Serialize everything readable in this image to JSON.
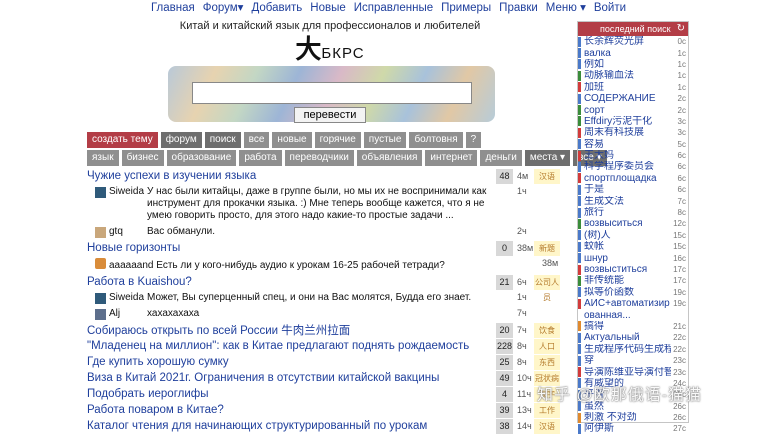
{
  "nav": [
    "Главная",
    "Форум▾",
    "Добавить",
    "Новые",
    "Исправленные",
    "Примеры",
    "Правки",
    "Меню ▾",
    "Войти"
  ],
  "subtitle": "Китай и китайский язык для профессионалов и любителей",
  "logo": {
    "char": "大",
    "text": "БКРС"
  },
  "search": {
    "value": "",
    "button": "перевести"
  },
  "row1": [
    "создать тему",
    "форум",
    "поиск",
    "все",
    "новые",
    "горячие",
    "пустые",
    "болтовня",
    "?"
  ],
  "row2": [
    "язык",
    "бизнес",
    "образование",
    "работа",
    "переводчики",
    "объявления",
    "интернет",
    "деньги",
    "места ▾",
    "все ▾"
  ],
  "threads": [
    {
      "title": "Чужие успехи в изучении языка",
      "count": "48",
      "age": "4м",
      "tag": "汉语"
    },
    {
      "post": {
        "user": "Siweida",
        "text": "У нас были китайцы, даже в группе были, но мы их не воспринимали как инструмент для прокачки языка. :) Мне теперь вообще кажется, что я не умею говорить просто, для этого надо какие-то простые задачи ...",
        "age": "1ч"
      }
    },
    {
      "post": {
        "user": "gtq",
        "text": "Вас обманули.",
        "age": "2ч"
      }
    },
    {
      "title": "Новые горизонты",
      "count": "0",
      "age": "38м",
      "tag": "新题"
    },
    {
      "inline": {
        "user": "aaaaaand",
        "text": "Есть ли у кого-нибудь аудио к урокам 16-25 рабочей тетради?",
        "age": "38м"
      }
    },
    {
      "title": "Работа в Kuaishou?",
      "count": "21",
      "age": "6ч",
      "tag": "公司人员"
    },
    {
      "post": {
        "user": "Siweida",
        "text": "Может, Вы суперценный спец, и они на Вас молятся, Будда его знает.",
        "age": "1ч"
      }
    },
    {
      "post": {
        "user": "Alj",
        "text": "хахахахаха",
        "age": "7ч"
      }
    },
    {
      "title": "Собираюсь открыть по всей России 牛肉兰州拉面",
      "count": "20",
      "age": "7ч",
      "tag": "饮食"
    },
    {
      "title": "\"Младенец на миллион\": как в Китае предлагают поднять рождаемость",
      "count": "228",
      "age": "8ч",
      "tag": "人口"
    },
    {
      "title": "Где купить хорошую сумку",
      "count": "25",
      "age": "8ч",
      "tag": "东西"
    },
    {
      "title": "Виза в Китай 2021г. Ограничения в отсутствии китайской вакцины",
      "count": "49",
      "age": "10ч",
      "tag": "冠状病毒"
    },
    {
      "title": "Подобрать иероглифы",
      "count": "4",
      "age": "11ч",
      "tag": "汉字"
    },
    {
      "title": "Работа поваром в Китае?",
      "count": "39",
      "age": "13ч",
      "tag": "工作"
    },
    {
      "title": "Каталог чтения для начинающих структурированный по урокам",
      "count": "38",
      "age": "14ч",
      "tag": "汉语"
    }
  ],
  "sidebar": {
    "title": "последний поиск",
    "refresh": "↻",
    "items": [
      {
        "t": "长余辉荧光屏",
        "a": "0с",
        "c": "#4a79c9"
      },
      {
        "t": "валка",
        "a": "1с",
        "c": "#4a79c9"
      },
      {
        "t": "例如",
        "a": "1с",
        "c": "#4a79c9"
      },
      {
        "t": "动脉输血法",
        "a": "1с",
        "c": "#3a8c3a"
      },
      {
        "t": "加班",
        "a": "1с",
        "c": "#d23b3b"
      },
      {
        "t": "СОДЕРЖАНИЕ",
        "a": "2с",
        "c": "#4a79c9"
      },
      {
        "t": "сорт",
        "a": "2с",
        "c": "#3a8c3a"
      },
      {
        "t": "Effdiry污泥干化",
        "a": "3с",
        "c": "#3a8c3a"
      },
      {
        "t": "周末有科技展",
        "a": "3с",
        "c": "#d23b3b"
      },
      {
        "t": "容易",
        "a": "5с",
        "c": "#4a79c9"
      },
      {
        "t": "王大妈",
        "a": "6с",
        "c": "#d23b3b"
      },
      {
        "t": "科学程序委员会",
        "a": "6с",
        "c": "#4a79c9"
      },
      {
        "t": "спортплощадка",
        "a": "6с",
        "c": "#d23b3b"
      },
      {
        "t": "于是",
        "a": "6с",
        "c": "#4a79c9"
      },
      {
        "t": "生成文法",
        "a": "7с",
        "c": "#4a79c9"
      },
      {
        "t": "旅行",
        "a": "8с",
        "c": "#4a79c9"
      },
      {
        "t": "возвыситься",
        "a": "12с",
        "c": "#3a8c3a"
      },
      {
        "t": "(树)人",
        "a": "15с",
        "c": "#4a79c9"
      },
      {
        "t": "蚊帐",
        "a": "15с",
        "c": "#4a79c9"
      },
      {
        "t": "шнур",
        "a": "16с",
        "c": "#4a79c9"
      },
      {
        "t": "возвыститься",
        "a": "17с",
        "c": "#d23b3b"
      },
      {
        "t": "非传统能",
        "a": "17с",
        "c": "#3a8c3a"
      },
      {
        "t": "拟等价函数",
        "a": "19с",
        "c": "#4a79c9"
      },
      {
        "t": "АИС+автоматизир",
        "a": "19с",
        "c": "#d23b3b"
      },
      {
        "t": "ованная...",
        "a": "",
        "c": "#ffffff"
      },
      {
        "t": "搞得",
        "a": "21с",
        "c": "#e08a2e"
      },
      {
        "t": "Актуальный",
        "a": "22с",
        "c": "#4a79c9"
      },
      {
        "t": "生成程序代码生成程序",
        "a": "22с",
        "c": "#4a79c9"
      },
      {
        "t": "穿",
        "a": "23с",
        "c": "#4a79c9"
      },
      {
        "t": "导演陈维亚导演付智涛",
        "a": "23с",
        "c": "#d23b3b"
      },
      {
        "t": "有威望的",
        "a": "24с",
        "c": "#4a79c9"
      },
      {
        "t": "平滑",
        "a": "25с",
        "c": "#4a79c9"
      },
      {
        "t": "虽然",
        "a": "26с",
        "c": "#4a79c9"
      },
      {
        "t": "刺激 不对劲",
        "a": "26с",
        "c": "#e08a2e"
      },
      {
        "t": "阿伊斯",
        "a": "27с",
        "c": "#4a79c9"
      }
    ]
  },
  "watermark": "知乎 @欧那俄语-猫猫"
}
